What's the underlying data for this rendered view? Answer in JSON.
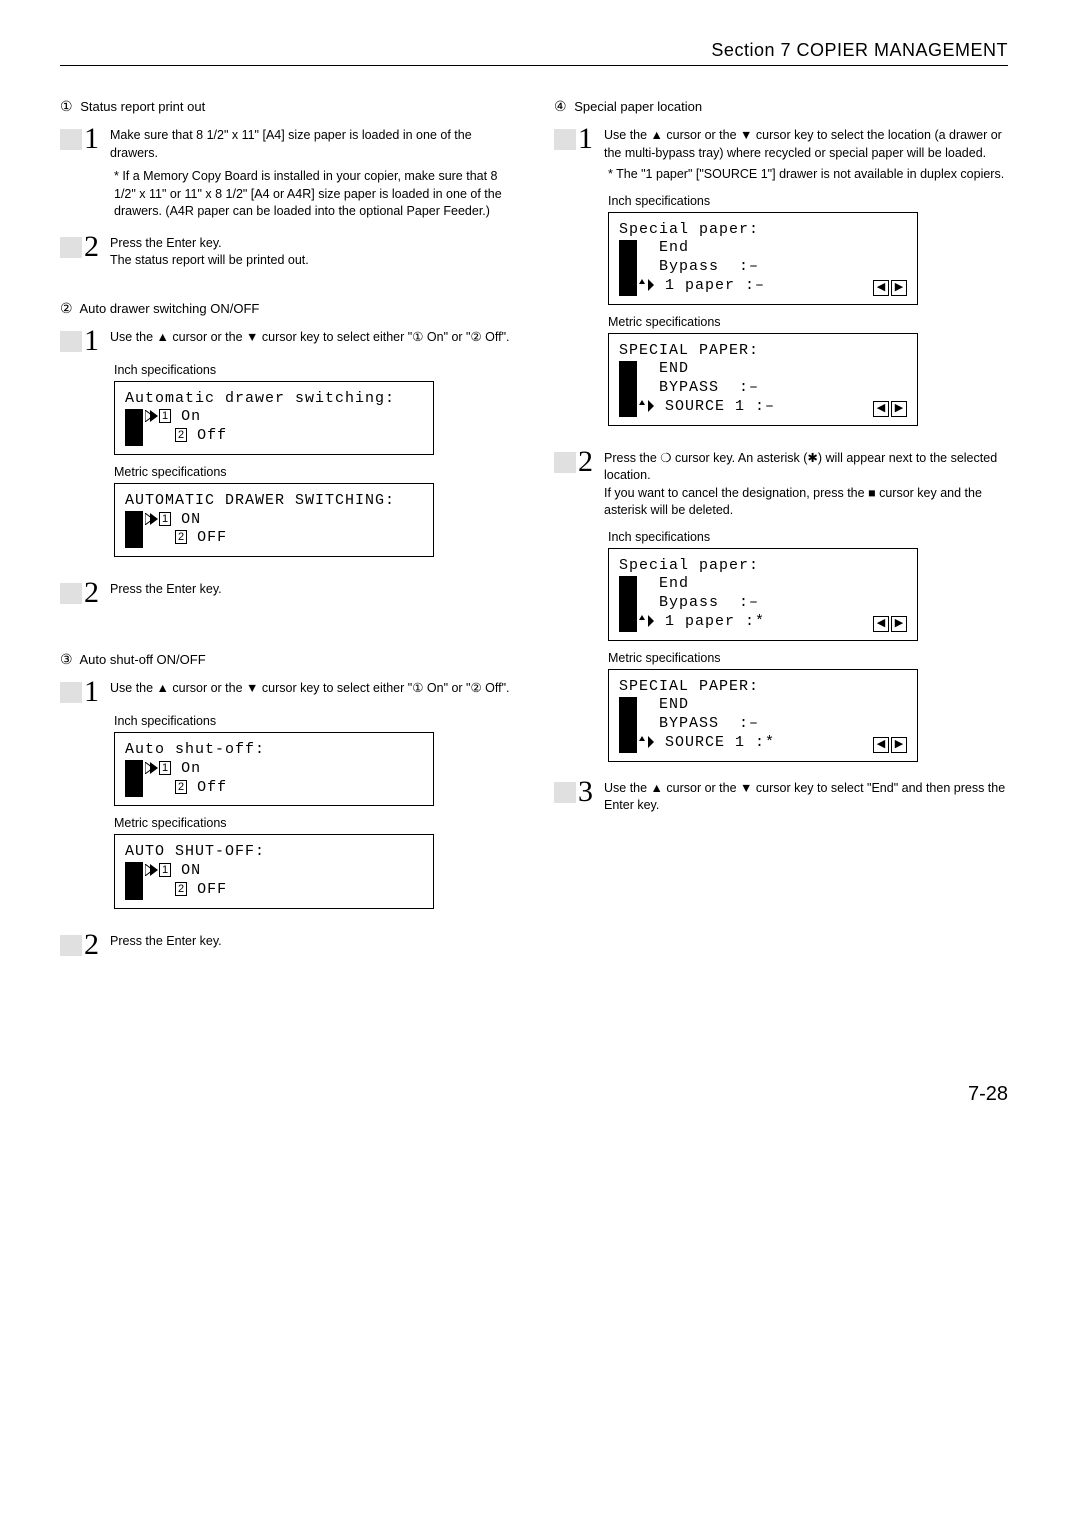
{
  "header": {
    "section": "Section 7  COPIER MANAGEMENT"
  },
  "page_number": "7-28",
  "left": {
    "item1": {
      "title_prefix": "①",
      "title": "Status report print out",
      "step1": {
        "num": "1",
        "text": "Make sure that 8 1/2\" x 11\" [A4] size paper is loaded in one of the drawers.",
        "note": "* If a Memory Copy Board is installed in your copier, make sure that 8 1/2\" x 11\" or 11\" x 8 1/2\" [A4 or A4R] size paper is loaded in one of the drawers. (A4R paper can be loaded into the optional Paper Feeder.)"
      },
      "step2": {
        "num": "2",
        "text1": "Press the Enter key.",
        "text2": "The status report will be printed out."
      }
    },
    "item2": {
      "title_prefix": "②",
      "title": "Auto drawer switching ON/OFF",
      "step1": {
        "num": "1",
        "text": "Use the ▲ cursor or the ▼ cursor key to select either \"① On\" or \"② Off\"."
      },
      "inch_label": "Inch specifications",
      "inch_screen": {
        "title": "Automatic drawer switching:",
        "opt1": "On",
        "opt2": "Off"
      },
      "metric_label": "Metric specifications",
      "metric_screen": {
        "title": "AUTOMATIC DRAWER SWITCHING:",
        "opt1": "ON",
        "opt2": "OFF"
      },
      "step2": {
        "num": "2",
        "text": "Press the Enter key."
      }
    },
    "item3": {
      "title_prefix": "③",
      "title": "Auto shut-off ON/OFF",
      "step1": {
        "num": "1",
        "text": "Use the ▲ cursor or the ▼ cursor key to select either \"① On\" or \"② Off\"."
      },
      "inch_label": "Inch specifications",
      "inch_screen": {
        "title": "Auto shut-off:",
        "opt1": "On",
        "opt2": "Off"
      },
      "metric_label": "Metric specifications",
      "metric_screen": {
        "title": "AUTO SHUT-OFF:",
        "opt1": "ON",
        "opt2": "OFF"
      },
      "step2": {
        "num": "2",
        "text": "Press the Enter key."
      }
    }
  },
  "right": {
    "item4": {
      "title_prefix": "④",
      "title": "Special paper location",
      "step1": {
        "num": "1",
        "text": "Use the ▲ cursor or the ▼ cursor key to select the location (a drawer or the multi-bypass tray) where recycled or special paper will be loaded.",
        "note": "* The \"1 paper\" [\"SOURCE 1\"] drawer is not available in duplex copiers."
      },
      "inch_label": "Inch specifications",
      "inch_screen": {
        "title": "Special paper:",
        "l1": "End",
        "l2": "Bypass  :–",
        "l3": "1 paper :–"
      },
      "metric_label": "Metric specifications",
      "metric_screen": {
        "title": "SPECIAL PAPER:",
        "l1": "END",
        "l2": "BYPASS  :–",
        "l3": "SOURCE 1 :–"
      },
      "step2": {
        "num": "2",
        "text": "Press the ❍ cursor key. An asterisk (✱) will appear next to the selected location.",
        "note": "If you want to cancel the designation, press the ■ cursor key and the asterisk will be deleted."
      },
      "inch_label2": "Inch specifications",
      "inch_screen2": {
        "title": "Special paper:",
        "l1": "End",
        "l2": "Bypass  :–",
        "l3": "1 paper :*"
      },
      "metric_label2": "Metric specifications",
      "metric_screen2": {
        "title": "SPECIAL PAPER:",
        "l1": "END",
        "l2": "BYPASS  :–",
        "l3": "SOURCE 1 :*"
      },
      "step3": {
        "num": "3",
        "text": "Use the ▲ cursor or the ▼ cursor key to select \"End\" and then press the Enter key."
      }
    }
  }
}
